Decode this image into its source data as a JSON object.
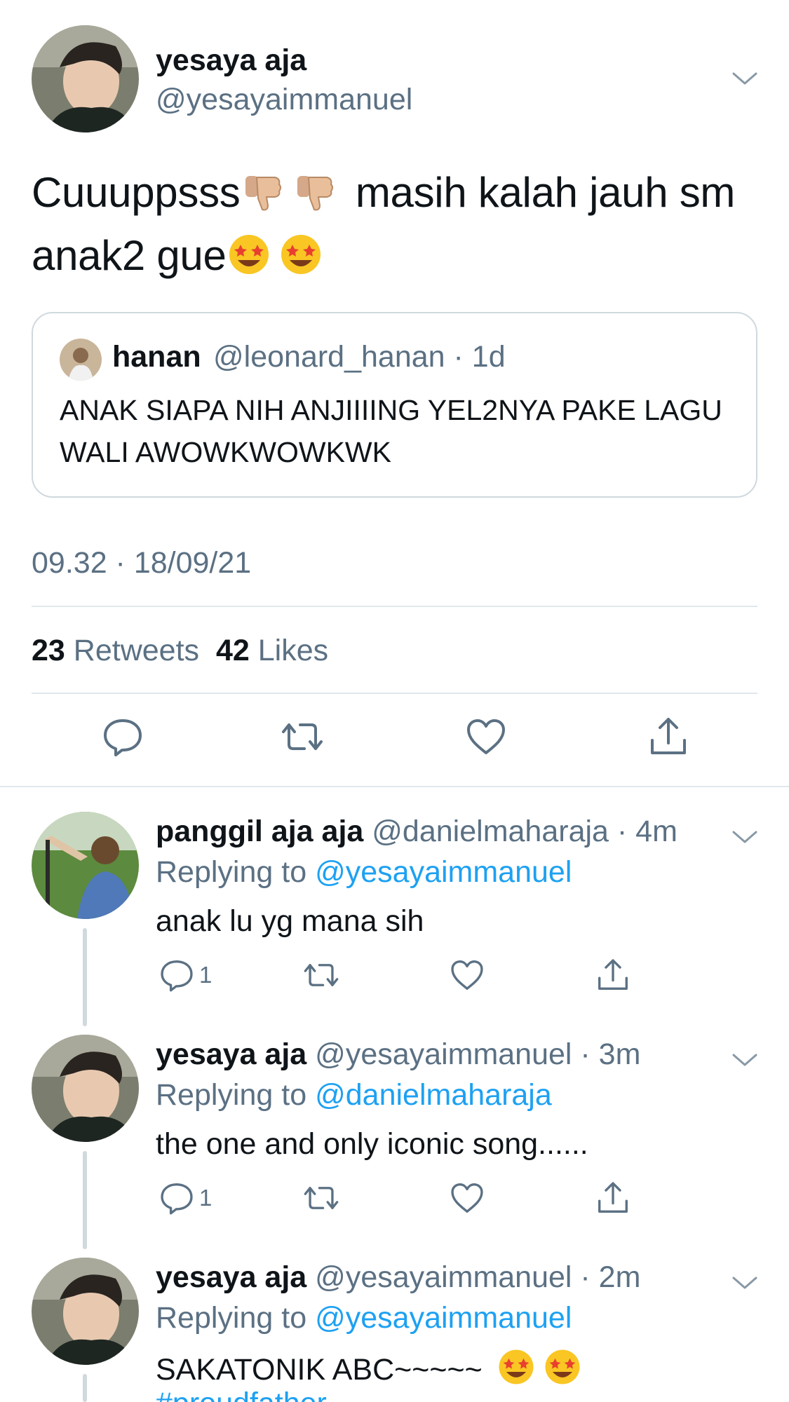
{
  "main_tweet": {
    "name": "yesaya aja",
    "handle": "@yesayaimmanuel",
    "text_part1": "Cuuuppsss",
    "text_part2": "masih kalah jauh sm",
    "text_part3": "anak2 gue",
    "emojis": [
      "thumbs-down",
      "thumbs-down",
      "star-struck",
      "star-struck"
    ],
    "timestamp": "09.32 · 18/09/21",
    "retweet_count": "23",
    "retweet_label": "Retweets",
    "like_count": "42",
    "like_label": "Likes"
  },
  "quoted_tweet": {
    "name": "hanan",
    "handle_time": "@leonard_hanan · 1d",
    "text": "ANAK SIAPA NIH ANJIIIING YEL2NYA PAKE LAGU WALI AWOWKWOWKWK"
  },
  "action_icons": [
    "reply-icon",
    "retweet-icon",
    "like-icon",
    "share-icon"
  ],
  "replies": [
    {
      "name": "panggil aja aja",
      "handle_time": "@danielmaharaja · 4m",
      "replying_label": "Replying to",
      "replying_to": "@yesayaimmanuel",
      "text": "anak lu yg mana sih",
      "reply_count": "1"
    },
    {
      "name": "yesaya aja",
      "handle_time": "@yesayaimmanuel · 3m",
      "replying_label": "Replying to",
      "replying_to": "@danielmaharaja",
      "text": "the one and only iconic song......",
      "reply_count": "1"
    },
    {
      "name": "yesaya aja",
      "handle_time": "@yesayaimmanuel · 2m",
      "replying_label": "Replying to",
      "replying_to": "@yesayaimmanuel",
      "text": "SAKATONIK ABC~~~~~",
      "hashtag": "#proudfather"
    }
  ],
  "colors": {
    "text": "#0f1419",
    "secondary": "#5b7083",
    "link": "#1da1f2",
    "border": "#cfd9de"
  }
}
